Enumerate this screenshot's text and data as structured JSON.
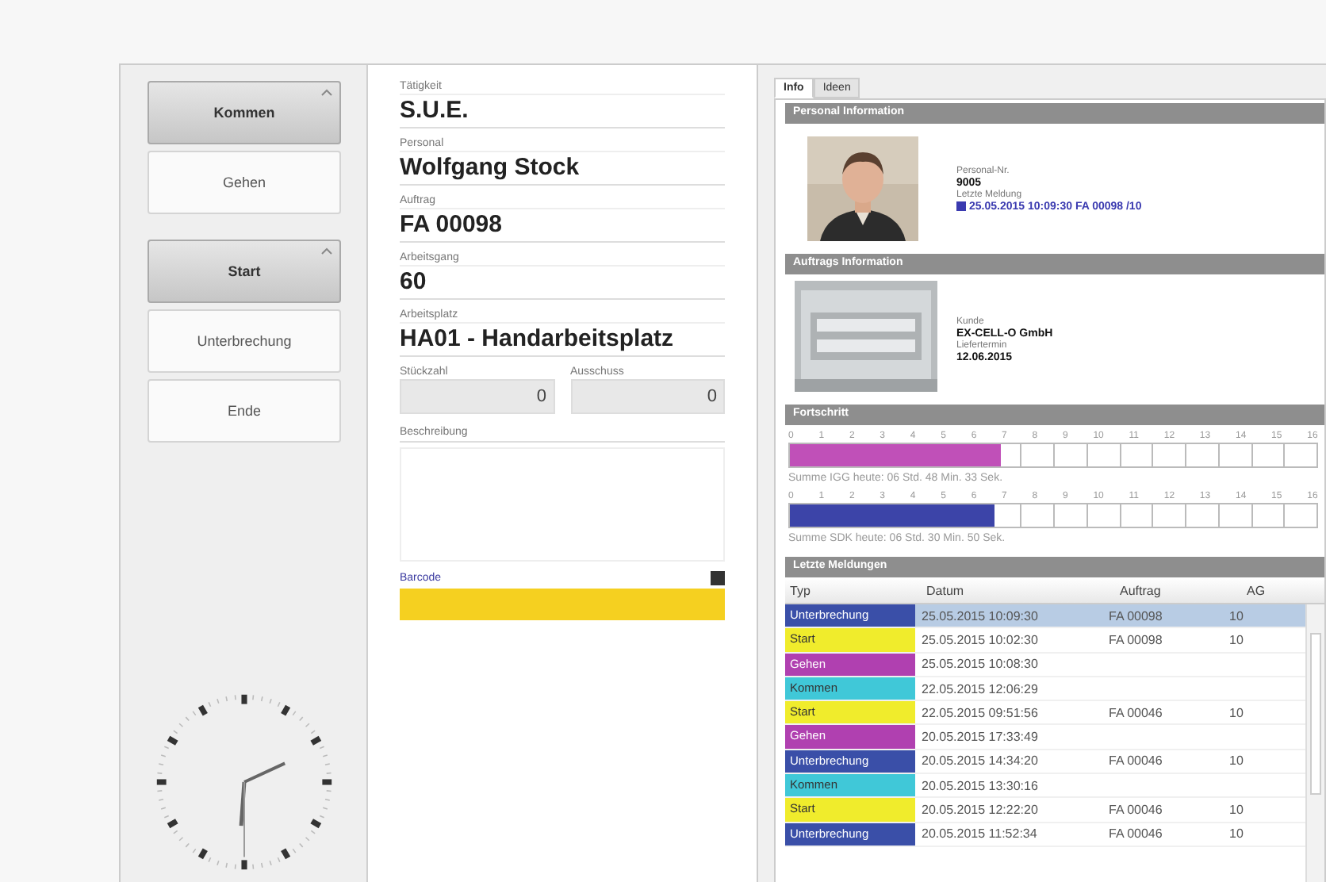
{
  "left": {
    "groups": [
      {
        "buttons": [
          {
            "label": "Kommen",
            "kind": "primary"
          },
          {
            "label": "Gehen",
            "kind": "secondary"
          }
        ]
      },
      {
        "buttons": [
          {
            "label": "Start",
            "kind": "primary"
          },
          {
            "label": "Unterbrechung",
            "kind": "secondary"
          },
          {
            "label": "Ende",
            "kind": "secondary"
          }
        ]
      }
    ]
  },
  "form": {
    "fields": [
      {
        "label": "Tätigkeit",
        "value": "S.U.E.",
        "kind": "text"
      },
      {
        "label": "Personal",
        "value": "Wolfgang Stock",
        "kind": "text"
      },
      {
        "label": "Auftrag",
        "value": "FA 00098",
        "kind": "text"
      },
      {
        "label": "Arbeitsgang",
        "value": "60",
        "kind": "text"
      },
      {
        "label": "Arbeitsplatz",
        "value": "HA01 - Handarbeitsplatz",
        "kind": "text"
      },
      {
        "label": "Stückzahl",
        "value": "0",
        "kind": "number"
      },
      {
        "label": "Ausschuss",
        "value": "0",
        "kind": "number"
      },
      {
        "label": "Beschreibung",
        "kind": "memo"
      }
    ],
    "barcode": {
      "label": "Barcode"
    }
  },
  "tabs": [
    {
      "label": "Info",
      "selected": true
    },
    {
      "label": "Ideen",
      "selected": false
    }
  ],
  "personal": {
    "title": "Personal Information",
    "number_label": "Personal-Nr.",
    "number": "9005",
    "last_label": "Letzte Meldung",
    "last": "25.05.2015 10:09:30 FA 00098 /10"
  },
  "order": {
    "title": "Auftrags Information",
    "customer_label": "Kunde",
    "customer": "EX-CELL-O GmbH",
    "date_label": "Liefertermin",
    "date": "12.06.2015"
  },
  "progress": {
    "title": "Fortschritt",
    "bars": [
      {
        "ticks": [
          "0",
          "1",
          "2",
          "3",
          "4",
          "5",
          "6",
          "7",
          "8",
          "9",
          "10",
          "11",
          "12",
          "13",
          "14",
          "15",
          "16"
        ],
        "color": "#c050b8",
        "level": 0.4,
        "summary": "Summe IGG heute: 06 Std. 48 Min. 33 Sek."
      },
      {
        "ticks": [
          "0",
          "1",
          "2",
          "3",
          "4",
          "5",
          "6",
          "7",
          "8",
          "9",
          "10",
          "11",
          "12",
          "13",
          "14",
          "15",
          "16"
        ],
        "color": "#3c44a8",
        "level": 0.39,
        "summary": "Summe SDK heute: 06 Std. 30 Min. 50 Sek."
      }
    ]
  },
  "messages": {
    "title": "Letzte Meldungen",
    "columns": [
      "Typ",
      "Datum",
      "Auftrag",
      "AG"
    ],
    "rows": [
      {
        "type": "Unterbrechung",
        "color": "#3a4fa8",
        "date": "25.05.2015 10:09:30",
        "order": "FA 00098",
        "ag": "10",
        "selected": true
      },
      {
        "type": "Start",
        "color": "#f0ec2c",
        "date": "25.05.2015 10:02:30",
        "order": "FA 00098",
        "ag": "10",
        "selected": false
      },
      {
        "type": "Gehen",
        "color": "#b040b0",
        "date": "25.05.2015 10:08:30",
        "selected": false
      },
      {
        "type": "Kommen",
        "color": "#40c8d8",
        "date": "22.05.2015 12:06:29",
        "selected": false
      },
      {
        "type": "Start",
        "color": "#f0ec2c",
        "date": "22.05.2015 09:51:56",
        "order": "FA 00046",
        "ag": "10",
        "selected": false
      },
      {
        "type": "Gehen",
        "color": "#b040b0",
        "date": "20.05.2015 17:33:49",
        "selected": false
      },
      {
        "type": "Unterbrechung",
        "color": "#3a4fa8",
        "date": "20.05.2015 14:34:20",
        "order": "FA 00046",
        "ag": "10",
        "selected": false
      },
      {
        "type": "Kommen",
        "color": "#40c8d8",
        "date": "20.05.2015 13:30:16",
        "selected": false
      },
      {
        "type": "Start",
        "color": "#f0ec2c",
        "date": "20.05.2015 12:22:20",
        "order": "FA 00046",
        "ag": "10",
        "selected": false
      },
      {
        "type": "Unterbrechung",
        "color": "#3a4fa8",
        "date": "20.05.2015 11:52:34",
        "order": "FA 00046",
        "ag": "10",
        "selected": false
      }
    ]
  }
}
